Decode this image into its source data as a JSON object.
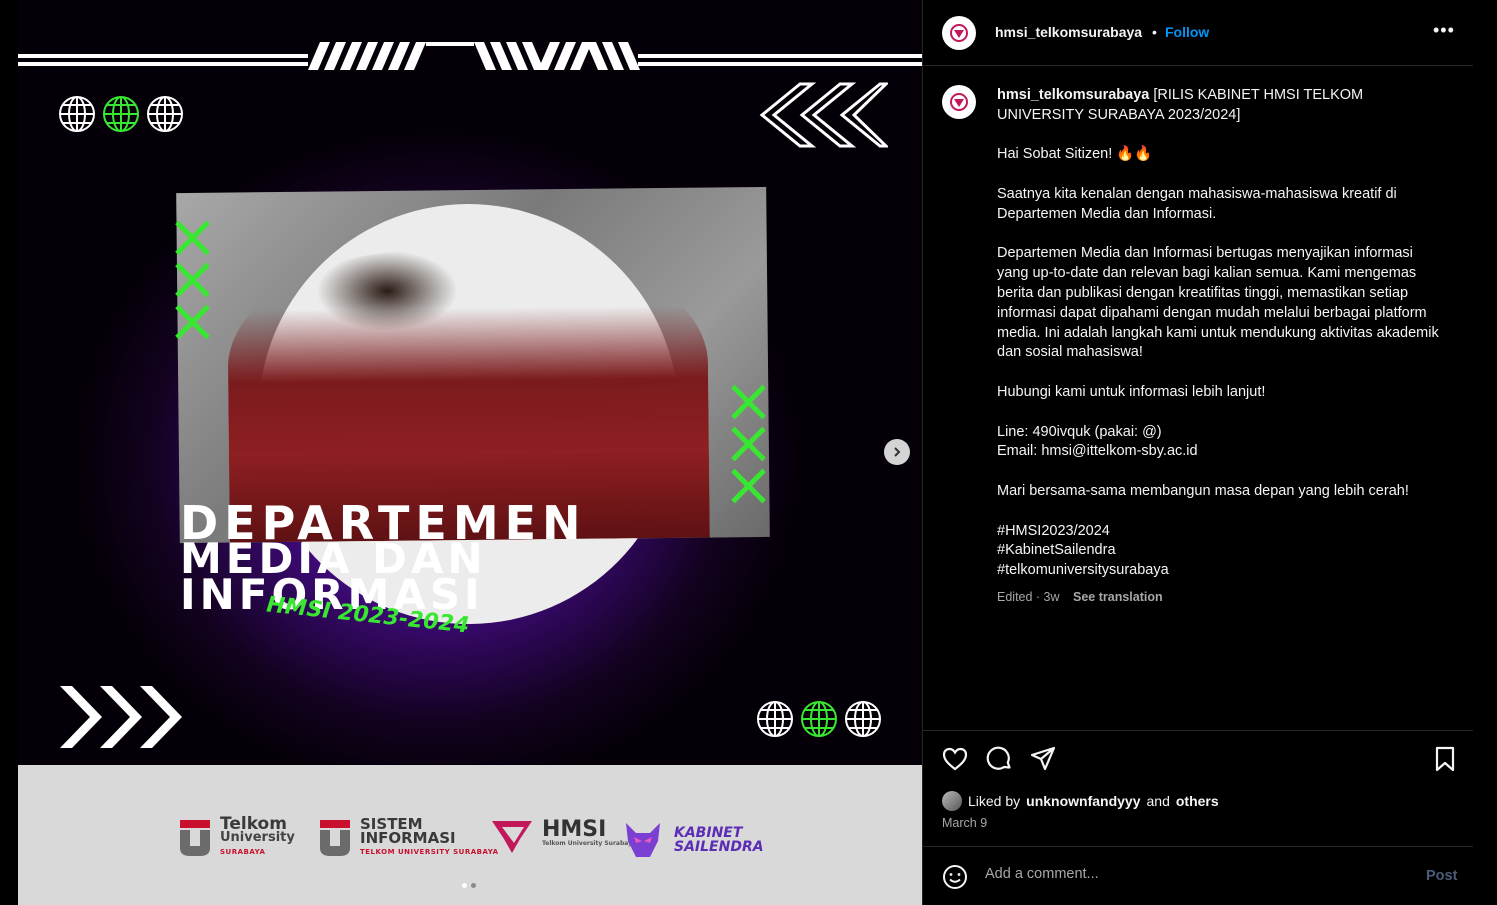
{
  "post_image": {
    "headline_line1": "DEPARTEMEN",
    "headline_line2": "MEDIA DAN",
    "headline_line3": "INFORMASI",
    "tagline": "HMSI 2023-2024",
    "logos": [
      {
        "main": "Telkom",
        "sub": "University",
        "tag": "SURABAYA"
      },
      {
        "main": "SISTEM",
        "sub": "INFORMASI",
        "tag": "TELKOM UNIVERSITY SURABAYA"
      },
      {
        "main": "HMSI",
        "sub": "",
        "tag": "Telkom University Surabaya"
      },
      {
        "main": "KABINET",
        "sub": "SAILENDRA",
        "tag": ""
      }
    ],
    "carousel_total": 2,
    "carousel_active": 1
  },
  "header": {
    "username": "hmsi_telkomsurabaya",
    "separator": "•",
    "follow_label": "Follow",
    "more_label": "•••"
  },
  "caption": {
    "username": "hmsi_telkomsurabaya",
    "text": " [RILIS KABINET HMSI TELKOM UNIVERSITY SURABAYA 2023/2024]\n\nHai Sobat Sitizen! 🔥🔥\n\nSaatnya kita kenalan dengan mahasiswa-mahasiswa kreatif di Departemen Media dan Informasi.\n\nDepartemen Media dan Informasi bertugas menyajikan informasi yang up-to-date dan relevan bagi kalian semua. Kami mengemas berita dan publikasi dengan kreatifitas tinggi, memastikan setiap informasi dapat dipahami dengan mudah melalui berbagai platform media. Ini adalah langkah kami untuk mendukung aktivitas akademik dan sosial mahasiswa!\n\nHubungi kami untuk informasi lebih lanjut!\n\nLine: 490ivquk (pakai: @)\nEmail: hmsi@ittelkom-sby.ac.id\n\nMari bersama-sama membangun masa depan yang lebih cerah!\n\n#HMSI2023/2024\n#KabinetSailendra\n#telkomuniversitysurabaya",
    "edited": "Edited · 3w",
    "see_translation": "See translation"
  },
  "likes": {
    "prefix": "Liked by",
    "user": "unknownfandyyy",
    "and": "and",
    "others": "others"
  },
  "date": "March 9",
  "comment": {
    "placeholder": "Add a comment...",
    "post_label": "Post"
  },
  "colors": {
    "accent_blue": "#0095f6",
    "neon_green": "#39e632",
    "purple": "#6d1bb5"
  }
}
